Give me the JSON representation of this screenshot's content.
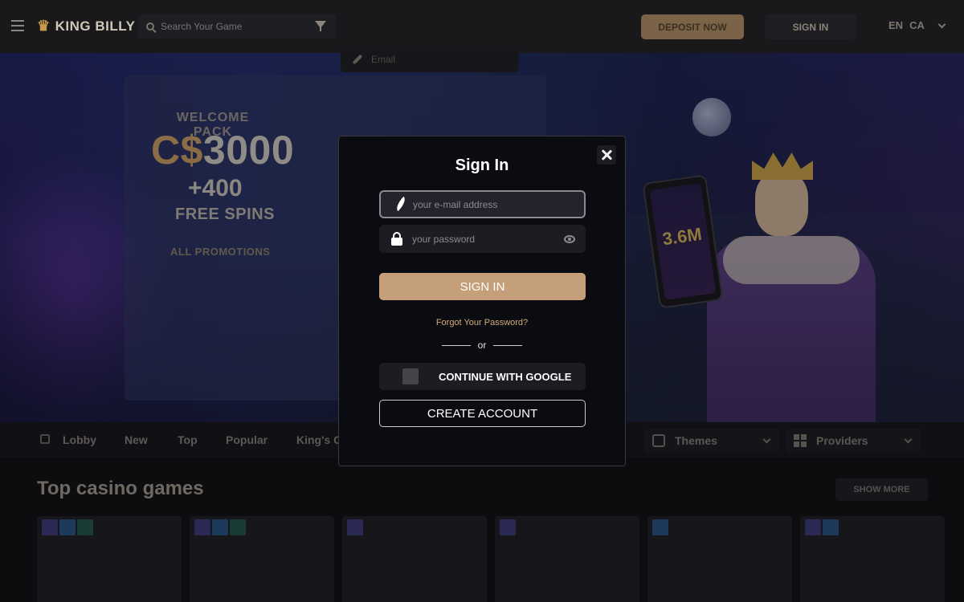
{
  "header": {
    "logo_text": "KING BILLY",
    "search_placeholder": "Search Your Game",
    "deposit_label": "DEPOSIT NOW",
    "signin_label": "SIGN IN",
    "language": "EN",
    "currency": "CA"
  },
  "hero": {
    "welcome_label": "WELCOME PACK",
    "amount_currency": "C$",
    "amount_value": "3000",
    "extra": "+400",
    "free_spins": "FREE SPINS",
    "promo_link": "ALL PROMOTIONS",
    "input_placeholder": "Email",
    "phone_text": "3.6M"
  },
  "tabs": {
    "items": [
      "Lobby",
      "New",
      "Top",
      "Popular",
      "King's C"
    ],
    "themes_label": "Themes",
    "providers_label": "Providers"
  },
  "games": {
    "section_title": "Top casino games",
    "show_more_label": "SHOW MORE"
  },
  "modal": {
    "title": "Sign In",
    "email_placeholder": "your e-mail address",
    "password_placeholder": "your password",
    "signin_button": "SIGN IN",
    "forgot_link": "Forgot Your Password?",
    "or_text": "or",
    "google_button": "CONTINUE WITH GOOGLE",
    "create_button": "CREATE ACCOUNT"
  },
  "colors": {
    "accent_gold": "#c59f79",
    "modal_bg": "#0b0b12",
    "link_gold": "#d3ac78"
  }
}
